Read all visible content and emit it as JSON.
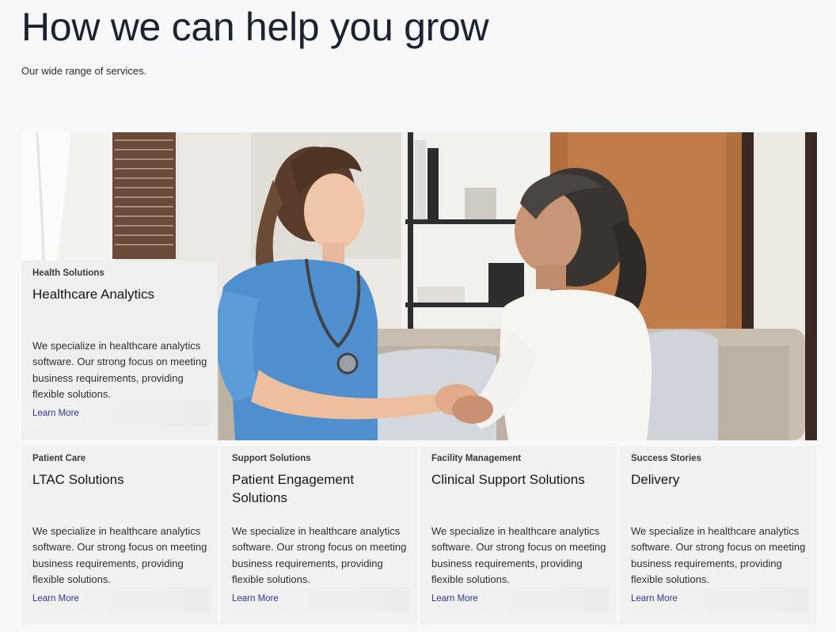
{
  "heading": "How we can help you grow",
  "subheading": "Our wide range of services.",
  "hero_image": {
    "icon": "photo-nurse-holding-hands-with-elderly-woman"
  },
  "featured_card": {
    "eyebrow": "Health Solutions",
    "title": "Healthcare Analytics",
    "body": "We specialize in healthcare analytics software. Our strong focus on meeting business requirements, providing flexible solutions.",
    "link": "Learn More"
  },
  "cards": [
    {
      "eyebrow": "Patient Care",
      "title": "LTAC Solutions",
      "body": "We specialize in healthcare analytics software. Our strong focus on meeting business requirements, providing flexible solutions.",
      "link": "Learn More"
    },
    {
      "eyebrow": "Support Solutions",
      "title": "Patient Engagement Solutions",
      "body": "We specialize in healthcare analytics software. Our strong focus on meeting business requirements, providing flexible solutions.",
      "link": "Learn More"
    },
    {
      "eyebrow": "Facility Management",
      "title": "Clinical Support Solutions",
      "body": "We specialize in healthcare analytics software. Our strong focus on meeting business requirements, providing flexible solutions.",
      "link": "Learn More"
    },
    {
      "eyebrow": "Success Stories",
      "title": "Delivery",
      "body": "We specialize in healthcare analytics software. Our strong focus on meeting business requirements, providing flexible solutions.",
      "link": "Learn More"
    }
  ],
  "colors": {
    "page_bg": "#f7f8fa",
    "card_bg": "#f1f1f1",
    "link": "#2b3a8c",
    "heading": "#1b2333"
  }
}
